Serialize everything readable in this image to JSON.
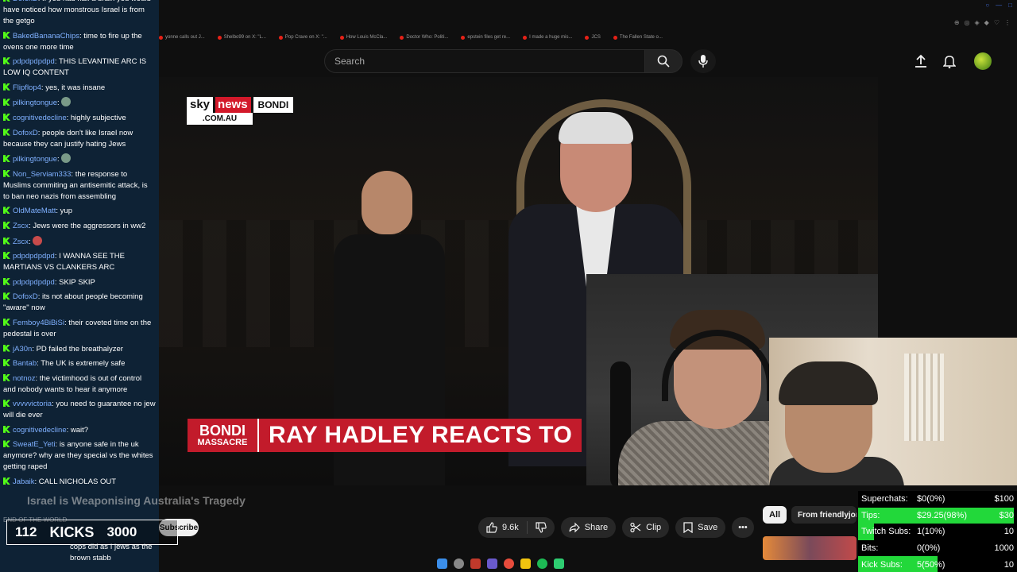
{
  "browser": {
    "bookmarks": [
      "yonne calls out J...",
      "Shelbo99 on X: \"L...",
      "Pop Crave on X: \"...",
      "How Louis McCla...",
      "Doctor Who: Politi...",
      "epstein files get re...",
      "I made a huge mis...",
      "JCS",
      "The Fallen State o..."
    ]
  },
  "youtube": {
    "search_placeholder": "Search",
    "video_title": "Israel is Weaponising Australia's Tragedy",
    "subscribe_label": "Subscribe",
    "like_count": "9.6k",
    "share_label": "Share",
    "clip_label": "Clip",
    "save_label": "Save",
    "chip_all": "All",
    "chip_channel": "From friendlyjordies"
  },
  "video": {
    "logo_sky": "sky",
    "logo_news": "news",
    "logo_tag": "BONDI",
    "logo_domain": ".COM.AU",
    "lower_tag_1": "BONDI",
    "lower_tag_2": "MASSACRE",
    "lower_headline": "RAY HADLEY REACTS TO"
  },
  "chat": {
    "messages": [
      {
        "user": "DofoxD",
        "text": "If you had half a brain you would have noticed how monstrous Israel is from the getgo"
      },
      {
        "user": "BakedBananaChips",
        "text": "time to fire up the ovens one more time"
      },
      {
        "user": "pdpdpdpdpd",
        "text": "THIS LEVANTINE ARC IS LOW IQ CONTENT"
      },
      {
        "user": "Flipflop4",
        "text": "yes, it was insane"
      },
      {
        "user": "pilkingtongue",
        "text": ""
      },
      {
        "user": "cognitivedecline",
        "text": "highly subjective"
      },
      {
        "user": "DofoxD",
        "text": "people don't like Israel now because they can justify hating Jews"
      },
      {
        "user": "pilkingtongue",
        "text": ""
      },
      {
        "user": "Non_Serviam333",
        "text": "the response to Muslims commiting an antisemitic attack, is to ban neo nazis from assembling"
      },
      {
        "user": "OldMateMatt",
        "text": "yup"
      },
      {
        "user": "Zscx",
        "text": "Jews were the aggressors in ww2"
      },
      {
        "user": "Zscx",
        "text": ""
      },
      {
        "user": "pdpdpdpdpd",
        "text": "I WANNA SEE THE MARTIANS VS CLANKERS ARC"
      },
      {
        "user": "pdpdpdpdpd",
        "text": "SKIP SKIP"
      },
      {
        "user": "DofoxD",
        "text": "its not about people becoming \"aware\" now"
      },
      {
        "user": "Femboy4BiBiSi",
        "text": "their coveted time on the pedestal is over"
      },
      {
        "user": "jA30n",
        "text": "PD failed the breathalyzer"
      },
      {
        "user": "Bantab",
        "text": "The UK is extremely safe"
      },
      {
        "user": "notnoz",
        "text": "the victimhood is out of control and nobody wants to hear it anymore"
      },
      {
        "user": "vvvvvictoria",
        "text": "you need to guarantee no jew will die ever"
      },
      {
        "user": "cognitivedecline",
        "text": "wait?"
      },
      {
        "user": "SweatE_Yeti",
        "text": "is anyone safe in the uk anymore? why are they special vs the whites getting raped"
      },
      {
        "user": "Jabaik",
        "text": "CALL NICHOLAS OUT"
      }
    ],
    "tail_text": "cops did as I jews as the brown stabb",
    "tail_text_faded": "END OF THE WORLD"
  },
  "kicks": {
    "count": "112",
    "label": "KICKS",
    "goal": "3000"
  },
  "stats": [
    {
      "label": "Superchats:",
      "value": "$0(0%)",
      "goal": "$100",
      "fill": 0
    },
    {
      "label": "Tips:",
      "value": "$29.25(98%)",
      "goal": "$30",
      "fill": 0.98
    },
    {
      "label": "Twitch Subs:",
      "value": "1(10%)",
      "goal": "10",
      "fill": 0.1
    },
    {
      "label": "Bits:",
      "value": "0(0%)",
      "goal": "1000",
      "fill": 0
    },
    {
      "label": "Kick Subs:",
      "value": "5(50%)",
      "goal": "10",
      "fill": 0.5
    }
  ],
  "colors": {
    "accent_green": "#22d83a",
    "kick_green": "#53fc18",
    "sky_red": "#d3192a"
  }
}
